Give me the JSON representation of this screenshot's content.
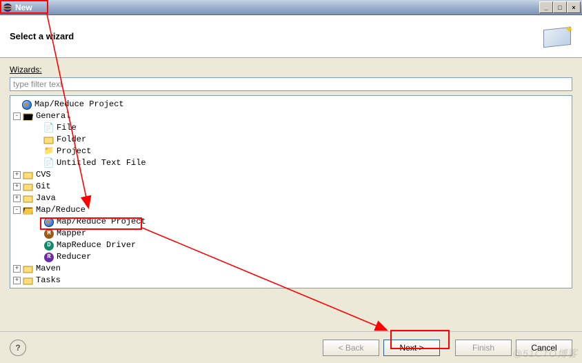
{
  "window": {
    "title": "New",
    "min": "_",
    "max": "□",
    "close": "×"
  },
  "banner": {
    "title": "Select a wizard"
  },
  "wizards_label": "Wizards:",
  "filter_placeholder": "type filter text",
  "tree": {
    "mr_project_top": "Map/Reduce Project",
    "general": "General",
    "general_children": {
      "file": "File",
      "folder": "Folder",
      "project": "Project",
      "untitled": "Untitled Text File"
    },
    "cvs": "CVS",
    "git": "Git",
    "java": "Java",
    "mapreduce": "Map/Reduce",
    "mr_children": {
      "project": "Map/Reduce Project",
      "mapper": "Mapper",
      "driver": "MapReduce Driver",
      "reducer": "Reducer"
    },
    "maven": "Maven",
    "tasks": "Tasks"
  },
  "buttons": {
    "back": "< Back",
    "next": "Next >",
    "finish": "Finish",
    "cancel": "Cancel",
    "help": "?"
  },
  "watermark": "@51CTO博客"
}
